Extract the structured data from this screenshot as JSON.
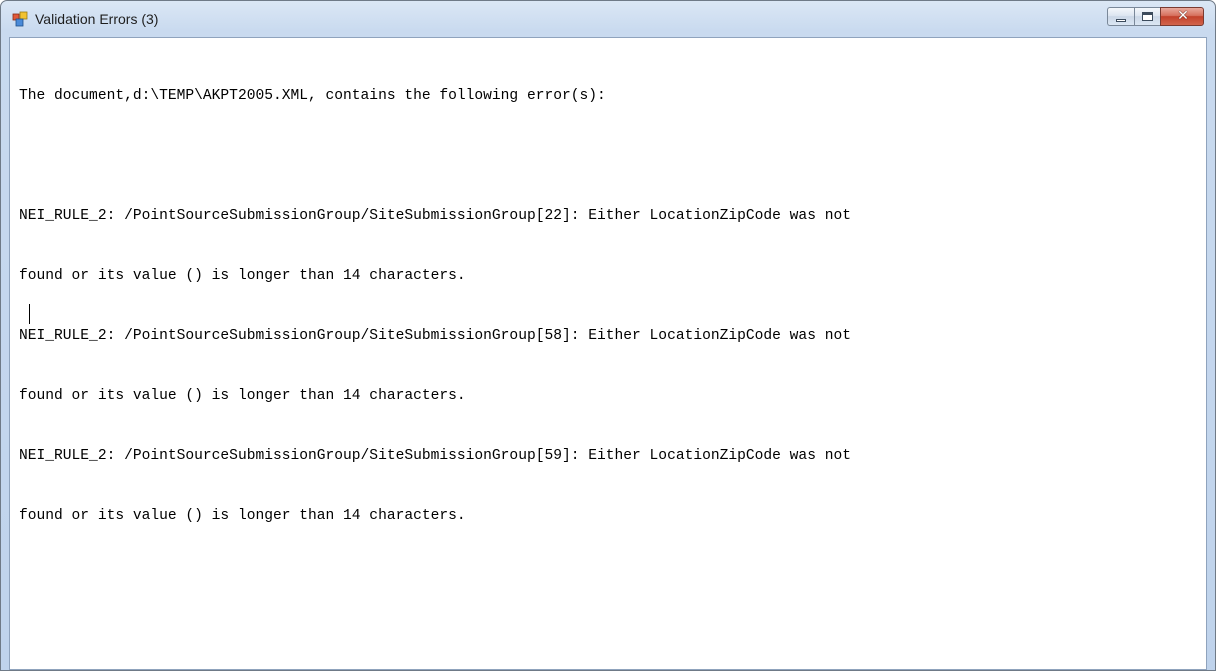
{
  "window": {
    "title": "Validation Errors (3)",
    "icon": "app-form-icon",
    "controls": {
      "minimize": "minimize-icon",
      "maximize": "maximize-icon",
      "close": "close-icon",
      "close_glyph": "✕"
    }
  },
  "content": {
    "header": "The document,d:\\TEMP\\AKPT2005.XML, contains the following error(s):",
    "lines": [
      "",
      "NEI_RULE_2: /PointSourceSubmissionGroup/SiteSubmissionGroup[22]: Either LocationZipCode was not",
      "found or its value () is longer than 14 characters.",
      "NEI_RULE_2: /PointSourceSubmissionGroup/SiteSubmissionGroup[58]: Either LocationZipCode was not",
      "found or its value () is longer than 14 characters.",
      "NEI_RULE_2: /PointSourceSubmissionGroup/SiteSubmissionGroup[59]: Either LocationZipCode was not",
      "found or its value () is longer than 14 characters."
    ]
  },
  "colors": {
    "titlebar": "#c9daef",
    "close_button": "#c2402a",
    "text": "#000000",
    "background": "#ffffff"
  }
}
